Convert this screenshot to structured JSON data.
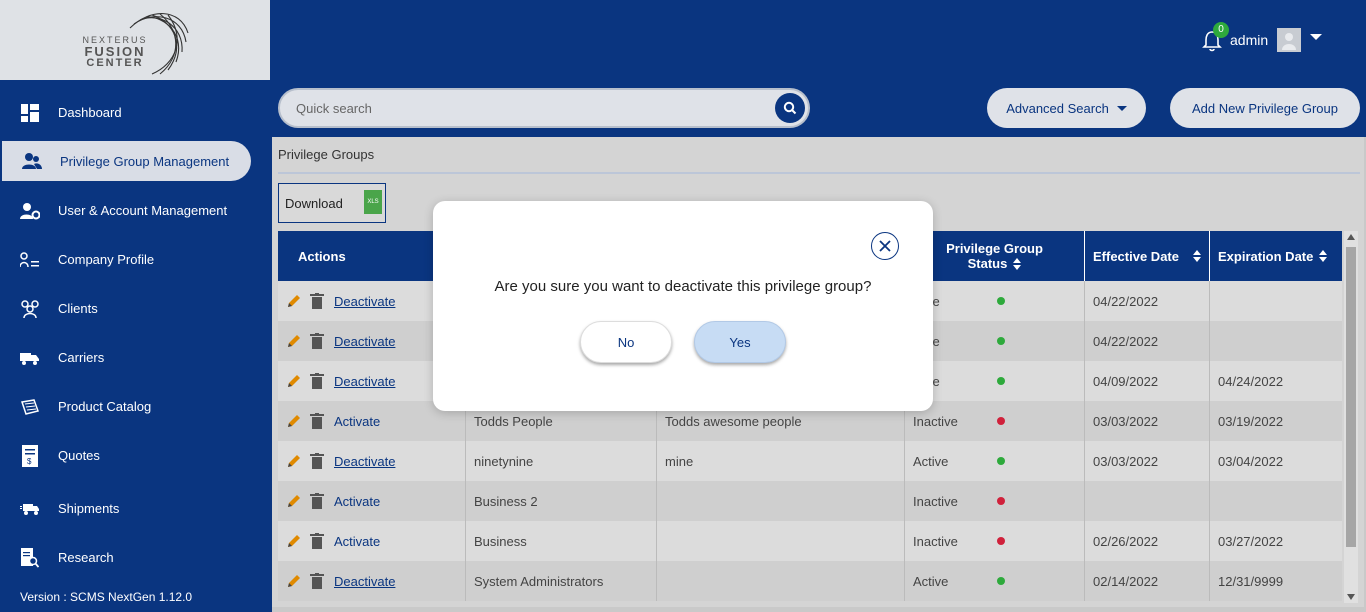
{
  "app": {
    "logo": {
      "line1": "NEXTERUS",
      "line2": "FUSION",
      "line3": "CENTER"
    },
    "version": "Version : SCMS NextGen 1.12.0"
  },
  "sidebar": {
    "items": [
      {
        "label": "Dashboard",
        "icon": "dashboard-icon"
      },
      {
        "label": "Privilege Group Management",
        "icon": "users-icon",
        "active": true
      },
      {
        "label": "User & Account Management",
        "icon": "user-gear-icon"
      },
      {
        "label": "Company Profile",
        "icon": "company-profile-icon"
      },
      {
        "label": "Clients",
        "icon": "clients-icon"
      },
      {
        "label": "Carriers",
        "icon": "truck-icon"
      },
      {
        "label": "Product Catalog",
        "icon": "catalog-icon"
      },
      {
        "label": "Quotes",
        "icon": "quote-icon"
      },
      {
        "label": "Shipments",
        "icon": "shipment-icon"
      },
      {
        "label": "Research",
        "icon": "research-icon"
      }
    ]
  },
  "header": {
    "notification_count": "0",
    "username": "admin"
  },
  "toolbar": {
    "search_placeholder": "Quick search",
    "advanced_search_label": "Advanced Search",
    "add_new_label": "Add New Privilege Group"
  },
  "panel": {
    "title": "Privilege Groups",
    "download_label": "Download",
    "xls_label": "XLS"
  },
  "table": {
    "headers": {
      "actions": "Actions",
      "status_line1": "Privilege Group",
      "status_line2": "Status",
      "effective": "Effective Date",
      "expiration": "Expiration Date"
    },
    "rows": [
      {
        "action": "Deactivate",
        "name": "",
        "description": "",
        "status": "ctive",
        "status_color": "#2eaa3c",
        "effective": "04/22/2022",
        "expiration": ""
      },
      {
        "action": "Deactivate",
        "name": "",
        "description": "",
        "status": "ctive",
        "status_color": "#2eaa3c",
        "effective": "04/22/2022",
        "expiration": ""
      },
      {
        "action": "Deactivate",
        "name": "",
        "description": "",
        "status": "ctive",
        "status_color": "#2eaa3c",
        "effective": "04/09/2022",
        "expiration": "04/24/2022"
      },
      {
        "action": "Activate",
        "name": "Todds People",
        "description": "Todds awesome people",
        "status": "Inactive",
        "status_color": "#d0213b",
        "effective": "03/03/2022",
        "expiration": "03/19/2022"
      },
      {
        "action": "Deactivate",
        "name": "ninetynine",
        "description": "mine",
        "status": "Active",
        "status_color": "#2eaa3c",
        "effective": "03/03/2022",
        "expiration": "03/04/2022"
      },
      {
        "action": "Activate",
        "name": "Business 2",
        "description": "",
        "status": "Inactive",
        "status_color": "#d0213b",
        "effective": "",
        "expiration": ""
      },
      {
        "action": "Activate",
        "name": "Business",
        "description": "",
        "status": "Inactive",
        "status_color": "#d0213b",
        "effective": "02/26/2022",
        "expiration": "03/27/2022"
      },
      {
        "action": "Deactivate",
        "name": "System Administrators",
        "description": "",
        "status": "Active",
        "status_color": "#2eaa3c",
        "effective": "02/14/2022",
        "expiration": "12/31/9999"
      }
    ]
  },
  "modal": {
    "message": "Are you sure you want to deactivate this privilege group?",
    "no_label": "No",
    "yes_label": "Yes"
  },
  "colors": {
    "brand": "#0a3580",
    "active_green": "#2eaa3c",
    "inactive_red": "#d0213b",
    "edit_orange": "#e08a00"
  }
}
